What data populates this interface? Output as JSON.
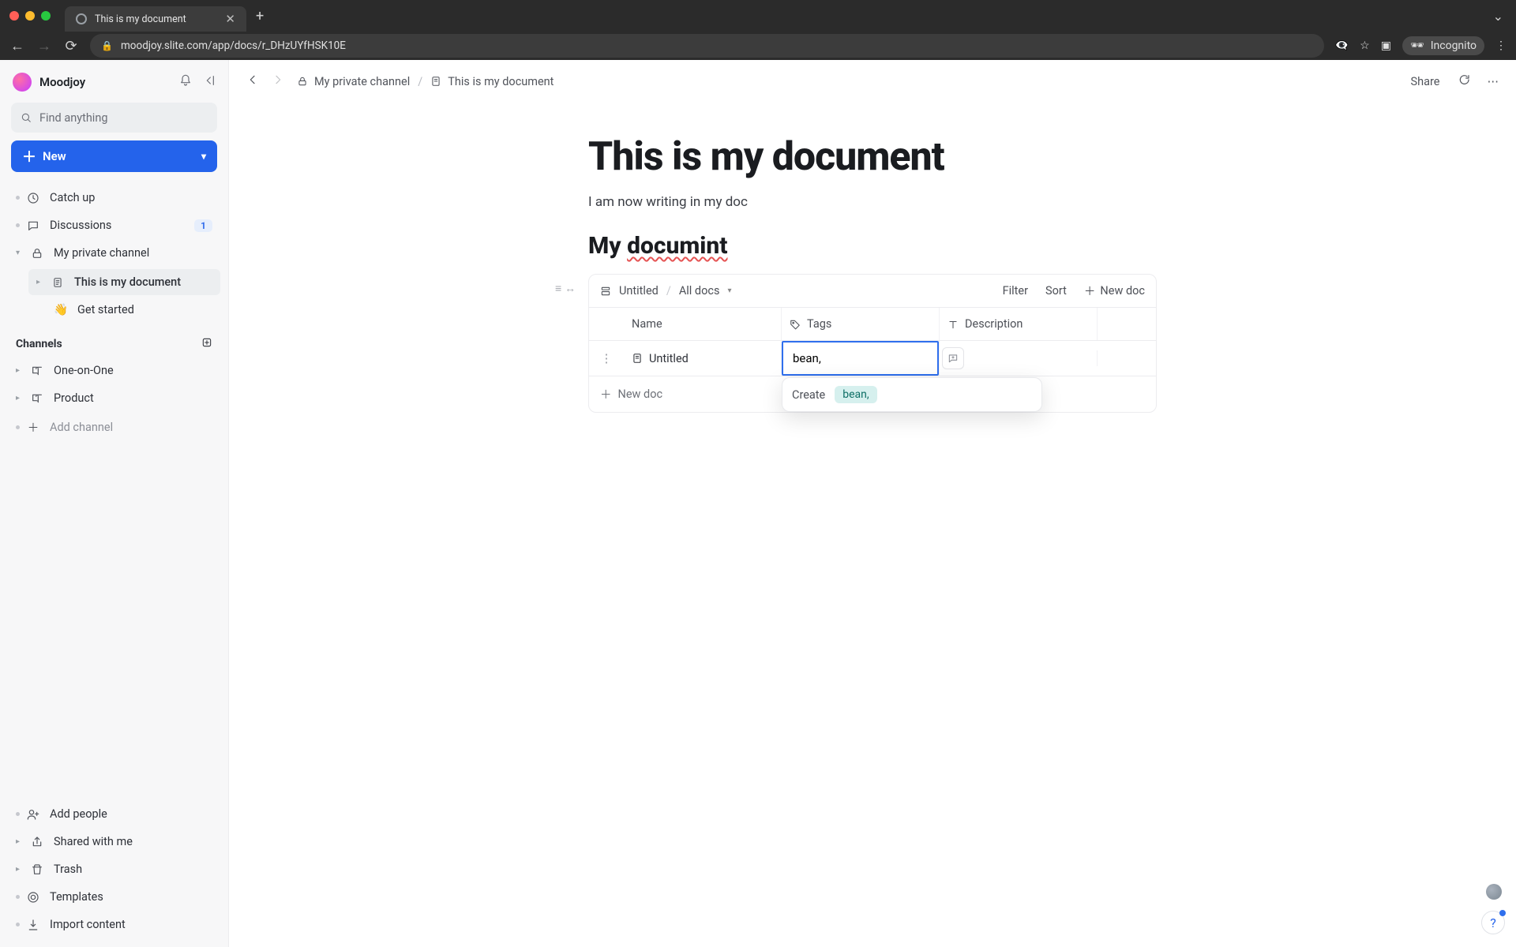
{
  "browser": {
    "tab_title": "This is my document",
    "url": "moodjoy.slite.com/app/docs/r_DHzUYfHSK10E",
    "incognito_label": "Incognito"
  },
  "workspace": {
    "name": "Moodjoy"
  },
  "search": {
    "placeholder": "Find anything"
  },
  "new_button": {
    "label": "New"
  },
  "nav": {
    "catch_up": "Catch up",
    "discussions": "Discussions",
    "discussions_badge": "1",
    "my_private_channel": "My private channel",
    "doc_current": "This is my document",
    "get_started": "Get started"
  },
  "channels": {
    "label": "Channels",
    "items": [
      "One-on-One",
      "Product"
    ],
    "add_channel": "Add channel"
  },
  "sidebar_footer": {
    "add_people": "Add people",
    "shared": "Shared with me",
    "trash": "Trash",
    "templates": "Templates",
    "import": "Import content"
  },
  "breadcrumb": {
    "channel": "My private channel",
    "doc": "This is my document"
  },
  "topbar": {
    "share": "Share"
  },
  "document": {
    "title": "This is my document",
    "paragraph": "I am now writing in my doc",
    "heading_prefix": "My ",
    "heading_misspell": "documint"
  },
  "collection": {
    "title": "Untitled",
    "scope": "All docs",
    "filter": "Filter",
    "sort": "Sort",
    "new_doc": "New doc",
    "columns": {
      "name": "Name",
      "tags": "Tags",
      "description": "Description"
    },
    "row": {
      "name": "Untitled",
      "tag_input_value": "bean,"
    },
    "new_doc_row": "New doc",
    "popover": {
      "create": "Create",
      "tag": "bean,"
    }
  }
}
